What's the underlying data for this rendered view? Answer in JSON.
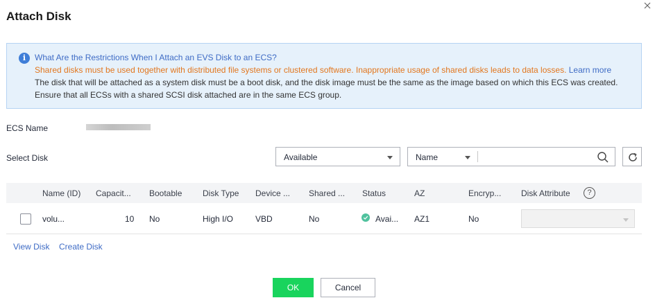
{
  "dialog": {
    "title": "Attach Disk"
  },
  "notice": {
    "heading": "What Are the Restrictions When I Attach an EVS Disk to an ECS?",
    "warning": "Shared disks must be used together with distributed file systems or clustered software. Inappropriate usage of shared disks leads to data losses.",
    "learn_more": "Learn more",
    "line3": "The disk that will be attached as a system disk must be a boot disk, and the disk image must be the same as the image based on which this ECS was created.",
    "line4": "Ensure that all ECSs with a shared SCSI disk attached are in the same ECS group."
  },
  "form": {
    "ecs_name_label": "ECS Name",
    "select_disk_label": "Select Disk"
  },
  "filters": {
    "status_value": "Available",
    "search_field": "Name",
    "search_value": ""
  },
  "table": {
    "columns": [
      "Name (ID)",
      "Capacit...",
      "Bootable",
      "Disk Type",
      "Device ...",
      "Shared ...",
      "Status",
      "AZ",
      "Encryp...",
      "Disk Attribute"
    ],
    "rows": [
      {
        "name": "volu...",
        "capacity": "10",
        "bootable": "No",
        "disk_type": "High I/O",
        "device": "VBD",
        "shared": "No",
        "status": "Avai...",
        "az": "AZ1",
        "encryption": "No",
        "disk_attribute": ""
      }
    ]
  },
  "links": {
    "view_disk": "View Disk",
    "create_disk": "Create Disk"
  },
  "buttons": {
    "ok": "OK",
    "cancel": "Cancel"
  },
  "colors": {
    "accent_green": "#19d45d",
    "link_blue": "#3e6bc5",
    "warning_orange": "#e2761d",
    "status_green": "#50c29e"
  },
  "icons": {
    "close": "close-icon",
    "info": "info-icon",
    "search": "search-icon",
    "refresh": "refresh-icon",
    "help": "help-icon"
  }
}
